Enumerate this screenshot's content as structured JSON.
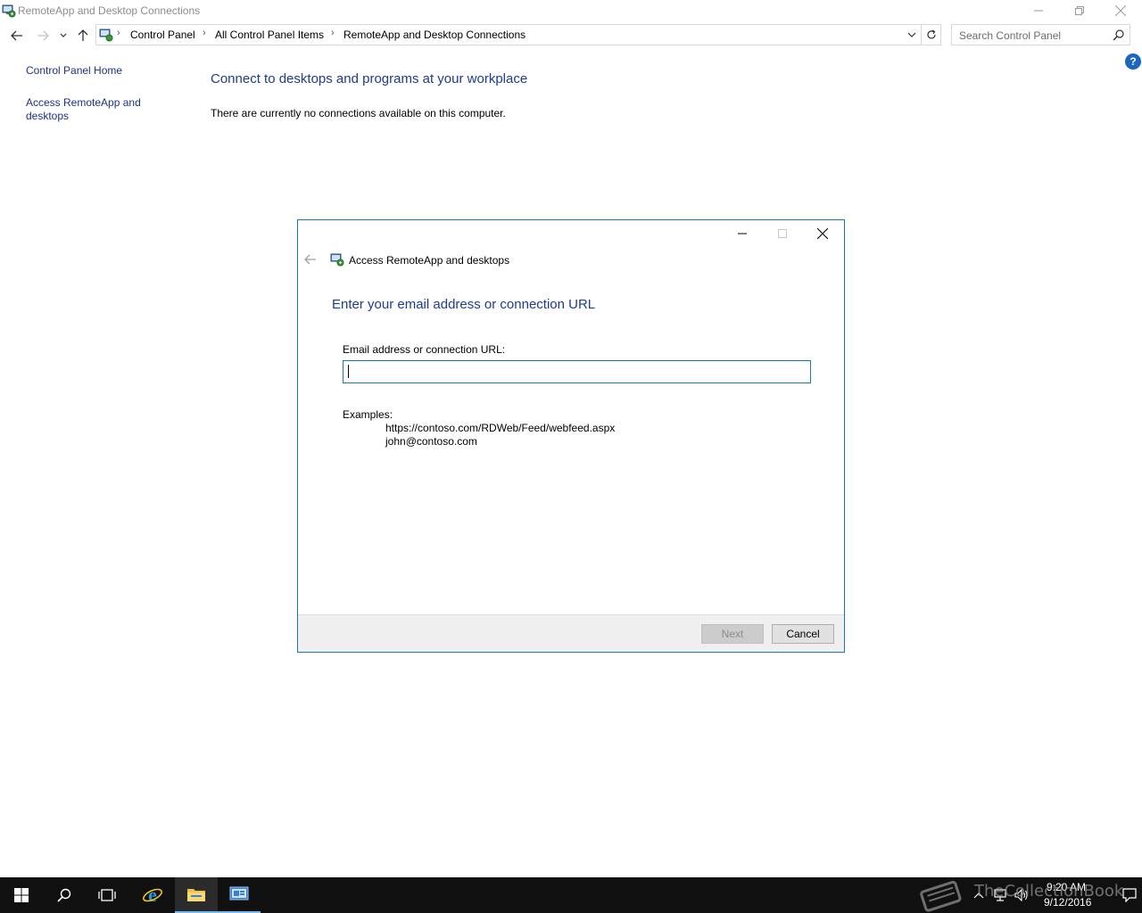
{
  "window": {
    "title": "RemoteApp and Desktop Connections",
    "icon": "remoteapp-icon"
  },
  "address_bar": {
    "breadcrumbs": [
      "Control Panel",
      "All Control Panel Items",
      "RemoteApp and Desktop Connections"
    ],
    "search_placeholder": "Search Control Panel"
  },
  "left_pane": {
    "links": [
      "Control Panel Home",
      "Access RemoteApp and desktops"
    ]
  },
  "main": {
    "heading": "Connect to desktops and programs at your workplace",
    "message": "There are currently no connections available on this computer."
  },
  "dialog": {
    "title": "Access RemoteApp and desktops",
    "heading": "Enter your email address or connection URL",
    "field_label": "Email address or connection URL:",
    "field_value": "",
    "examples_label": "Examples:",
    "examples": [
      "https://contoso.com/RDWeb/Feed/webfeed.aspx",
      "john@contoso.com"
    ],
    "next_label": "Next",
    "cancel_label": "Cancel",
    "next_enabled": false
  },
  "taskbar": {
    "apps": [
      "start-icon",
      "search-icon",
      "task-view-icon",
      "internet-explorer-icon",
      "file-explorer-icon",
      "remoteapp-icon"
    ],
    "time": "9:20 AM",
    "date": "9/12/2016",
    "watermark": "TheCollectionBook"
  },
  "colors": {
    "link": "#1e3287",
    "heading": "#1e3c8c",
    "accent_border": "#1979a9",
    "taskbar": "#101010",
    "help": "#1a66c0"
  }
}
